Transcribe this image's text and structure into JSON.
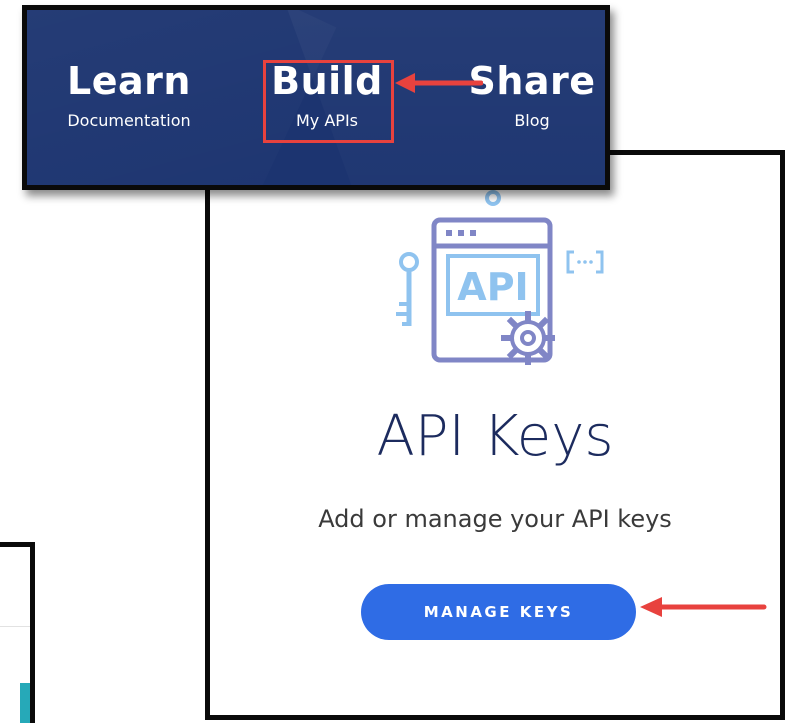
{
  "nav": {
    "items": [
      {
        "title": "Learn",
        "subtitle": "Documentation"
      },
      {
        "title": "Build",
        "subtitle": "My APIs"
      },
      {
        "title": "Share",
        "subtitle": "Blog"
      }
    ],
    "background_color": "#1c3470",
    "highlight_color": "#e8423e"
  },
  "card": {
    "illustration_icon": "api-gear-key-icon",
    "illustration_text": "API",
    "title": "API Keys",
    "description": "Add or manage your API keys",
    "button_label": "MANAGE KEYS",
    "button_color": "#2f6ce5"
  },
  "annotations": {
    "arrow_color": "#e8423e"
  },
  "background_panel": {
    "accent_color": "#26a9b8"
  }
}
